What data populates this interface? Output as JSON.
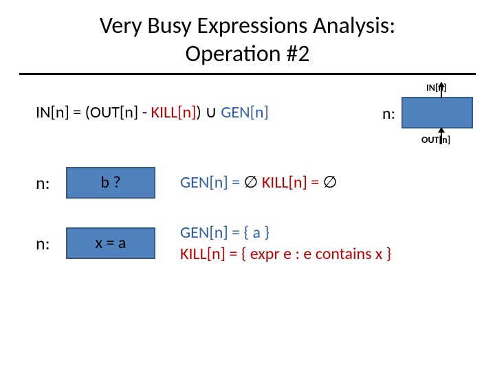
{
  "title": {
    "line1": "Very Busy Expressions Analysis:",
    "line2": "Operation #2"
  },
  "diagram": {
    "in_label": "IN[n]",
    "out_label": "OUT[n]",
    "n_label": "n:"
  },
  "formula": {
    "lhs": "IN[n] = (OUT[n] - ",
    "kill": "KILL[n]",
    "mid": ") ",
    "cup": "∪",
    "sp": " ",
    "gen": "GEN[n]"
  },
  "examples": [
    {
      "n": "n:",
      "code": "b ?",
      "gen_lhs": "GEN[n] = ",
      "gen_rhs": "∅",
      "kill_lhs": "   KILL[n] = ",
      "kill_rhs": "∅"
    },
    {
      "n": "n:",
      "code": "x = a",
      "gen": "GEN[n] = { a }",
      "kill": "KILL[n] = { expr e : e contains x }"
    }
  ]
}
